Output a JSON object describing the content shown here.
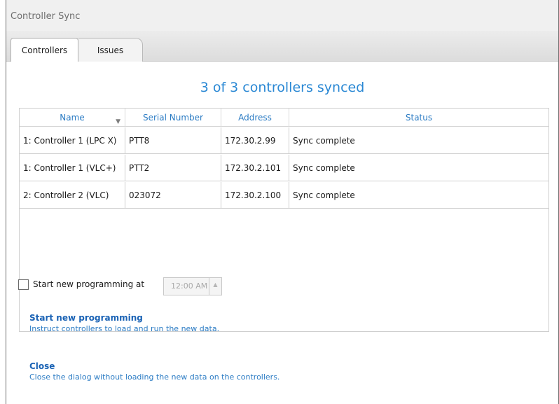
{
  "window": {
    "title": "Controller Sync"
  },
  "tabs": [
    {
      "label": "Controllers"
    },
    {
      "label": "Issues"
    }
  ],
  "summary": "3 of 3 controllers synced",
  "table": {
    "columns": [
      "Name",
      "Serial Number",
      "Address",
      "Status"
    ],
    "rows": [
      {
        "name": "1: Controller 1 (LPC X)",
        "serial": "PTT8",
        "address": "172.30.2.99",
        "status": "Sync complete"
      },
      {
        "name": "1: Controller 1 (VLC+)",
        "serial": "PTT2",
        "address": "172.30.2.101",
        "status": "Sync complete"
      },
      {
        "name": "2: Controller 2 (VLC)",
        "serial": "023072",
        "address": "172.30.2.100",
        "status": "Sync complete"
      }
    ]
  },
  "schedule": {
    "label": "Start new programming at",
    "checked": false,
    "time": "12:00 AM"
  },
  "actions": {
    "start": {
      "title": "Start new programming",
      "desc": "Instruct controllers to load and run the new data."
    },
    "close": {
      "title": "Close",
      "desc": "Close the dialog without loading the new data on the controllers."
    }
  },
  "colors": {
    "accent": "#2a88d4",
    "link": "#1b63b5",
    "header_text": "#2c7cc4"
  }
}
